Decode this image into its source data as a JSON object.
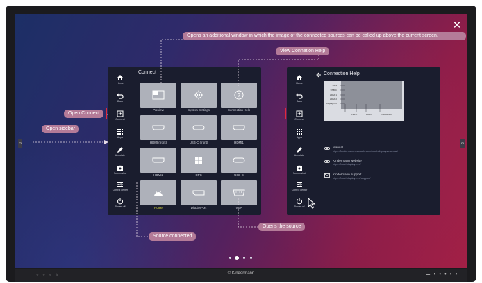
{
  "brand": "Kindermann",
  "sidebar_items": [
    {
      "label": "Home"
    },
    {
      "label": "Back"
    },
    {
      "label": "Connect"
    },
    {
      "label": "Apps"
    },
    {
      "label": "Annotate"
    },
    {
      "label": "Screenshot"
    },
    {
      "label": "Control center"
    },
    {
      "label": "Power off"
    }
  ],
  "connect_panel": {
    "title": "Connect",
    "tiles": [
      {
        "label": "Preview"
      },
      {
        "label": "System Settings"
      },
      {
        "label": "Connection Help"
      },
      {
        "label": "HDMI (front)"
      },
      {
        "label": "USB-C (front)"
      },
      {
        "label": "HDMI1"
      },
      {
        "label": "HDMI2"
      },
      {
        "label": "OPS"
      },
      {
        "label": "USB-C"
      },
      {
        "label": "Home"
      },
      {
        "label": "DisplayPort"
      },
      {
        "label": "VGA"
      }
    ]
  },
  "help_panel": {
    "title": "Connection Help",
    "diagram_ports": [
      "OPS",
      "USB-C",
      "HDMI 1",
      "HDMI 2",
      "DisplayPort"
    ],
    "diagram_bottom": [
      "USB-C",
      "HDMI",
      "VGA/HDMI"
    ],
    "links": [
      {
        "title": "Manual",
        "url": "https://kindermann-manuals.com/touchdisplays-manual/"
      },
      {
        "title": "Kindermann website",
        "url": "https://touchdisplays.eu/"
      },
      {
        "title": "Kindermann support",
        "url": "https://touchdisplays.eu/support/"
      }
    ]
  },
  "callouts": {
    "preview": "Opens an additional window in which the image of the connected sources can be called up above the current screen.",
    "help": "View Connetion Help",
    "open_connect": "Open Connect",
    "open_sidebar": "Open sidebar",
    "source_connected": "Source connected",
    "opens_source": "Opens the source"
  },
  "page_dots": {
    "count": 4,
    "active": 1
  }
}
